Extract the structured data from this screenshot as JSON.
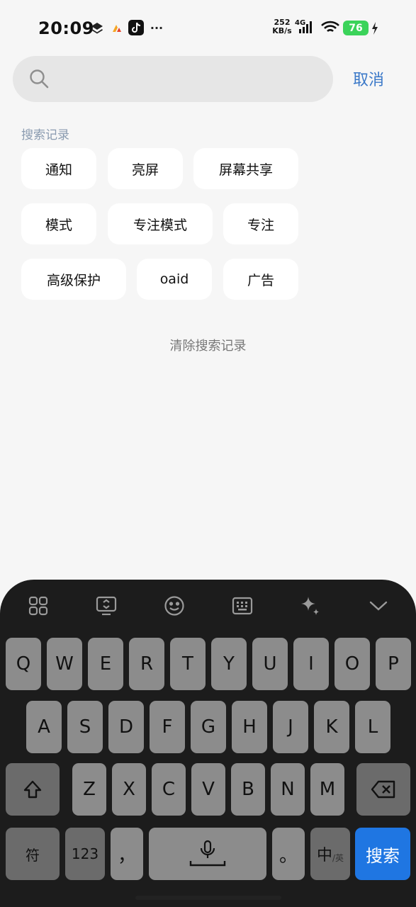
{
  "status_bar": {
    "time": "20:09",
    "net_speed_value": "252",
    "net_speed_unit": "KB/s",
    "network_type": "4G",
    "battery_level": "76",
    "more_indicator": "···"
  },
  "search": {
    "placeholder": "",
    "value": "",
    "cancel_label": "取消"
  },
  "history": {
    "title": "搜索记录",
    "items": [
      "通知",
      "亮屏",
      "屏幕共享",
      "模式",
      "专注模式",
      "专注",
      "高级保护",
      "oaid",
      "广告"
    ],
    "clear_label": "清除搜索记录"
  },
  "keyboard": {
    "toolbar_icons": [
      "grid-icon",
      "screen-icon",
      "emoji-icon",
      "keyboard-icon",
      "sparkle-icon",
      "chevron-down-icon"
    ],
    "row1": [
      "Q",
      "W",
      "E",
      "R",
      "T",
      "Y",
      "U",
      "I",
      "O",
      "P"
    ],
    "row2": [
      "A",
      "S",
      "D",
      "F",
      "G",
      "H",
      "J",
      "K",
      "L"
    ],
    "row3": [
      "Z",
      "X",
      "C",
      "V",
      "B",
      "N",
      "M"
    ],
    "symbols_label": "符",
    "numbers_label": "123",
    "comma_label": "，",
    "period_label": "。",
    "lang_primary": "中",
    "lang_secondary": "/英",
    "enter_label": "搜索"
  },
  "colors": {
    "accent": "#3a78c8",
    "enter_key": "#1f76e2",
    "battery": "#3bd35a"
  }
}
